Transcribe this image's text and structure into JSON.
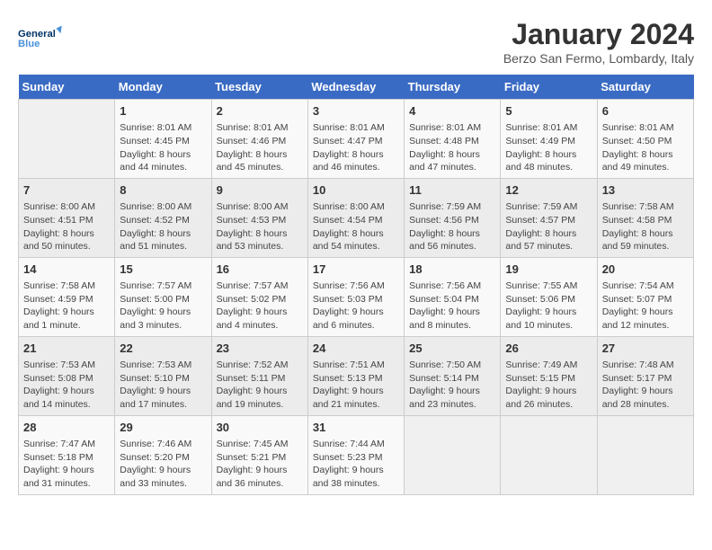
{
  "header": {
    "logo_line1": "General",
    "logo_line2": "Blue",
    "month": "January 2024",
    "location": "Berzo San Fermo, Lombardy, Italy"
  },
  "days_of_week": [
    "Sunday",
    "Monday",
    "Tuesday",
    "Wednesday",
    "Thursday",
    "Friday",
    "Saturday"
  ],
  "weeks": [
    [
      {
        "day": "",
        "info": ""
      },
      {
        "day": "1",
        "info": "Sunrise: 8:01 AM\nSunset: 4:45 PM\nDaylight: 8 hours\nand 44 minutes."
      },
      {
        "day": "2",
        "info": "Sunrise: 8:01 AM\nSunset: 4:46 PM\nDaylight: 8 hours\nand 45 minutes."
      },
      {
        "day": "3",
        "info": "Sunrise: 8:01 AM\nSunset: 4:47 PM\nDaylight: 8 hours\nand 46 minutes."
      },
      {
        "day": "4",
        "info": "Sunrise: 8:01 AM\nSunset: 4:48 PM\nDaylight: 8 hours\nand 47 minutes."
      },
      {
        "day": "5",
        "info": "Sunrise: 8:01 AM\nSunset: 4:49 PM\nDaylight: 8 hours\nand 48 minutes."
      },
      {
        "day": "6",
        "info": "Sunrise: 8:01 AM\nSunset: 4:50 PM\nDaylight: 8 hours\nand 49 minutes."
      }
    ],
    [
      {
        "day": "7",
        "info": "Sunrise: 8:00 AM\nSunset: 4:51 PM\nDaylight: 8 hours\nand 50 minutes."
      },
      {
        "day": "8",
        "info": "Sunrise: 8:00 AM\nSunset: 4:52 PM\nDaylight: 8 hours\nand 51 minutes."
      },
      {
        "day": "9",
        "info": "Sunrise: 8:00 AM\nSunset: 4:53 PM\nDaylight: 8 hours\nand 53 minutes."
      },
      {
        "day": "10",
        "info": "Sunrise: 8:00 AM\nSunset: 4:54 PM\nDaylight: 8 hours\nand 54 minutes."
      },
      {
        "day": "11",
        "info": "Sunrise: 7:59 AM\nSunset: 4:56 PM\nDaylight: 8 hours\nand 56 minutes."
      },
      {
        "day": "12",
        "info": "Sunrise: 7:59 AM\nSunset: 4:57 PM\nDaylight: 8 hours\nand 57 minutes."
      },
      {
        "day": "13",
        "info": "Sunrise: 7:58 AM\nSunset: 4:58 PM\nDaylight: 8 hours\nand 59 minutes."
      }
    ],
    [
      {
        "day": "14",
        "info": "Sunrise: 7:58 AM\nSunset: 4:59 PM\nDaylight: 9 hours\nand 1 minute."
      },
      {
        "day": "15",
        "info": "Sunrise: 7:57 AM\nSunset: 5:00 PM\nDaylight: 9 hours\nand 3 minutes."
      },
      {
        "day": "16",
        "info": "Sunrise: 7:57 AM\nSunset: 5:02 PM\nDaylight: 9 hours\nand 4 minutes."
      },
      {
        "day": "17",
        "info": "Sunrise: 7:56 AM\nSunset: 5:03 PM\nDaylight: 9 hours\nand 6 minutes."
      },
      {
        "day": "18",
        "info": "Sunrise: 7:56 AM\nSunset: 5:04 PM\nDaylight: 9 hours\nand 8 minutes."
      },
      {
        "day": "19",
        "info": "Sunrise: 7:55 AM\nSunset: 5:06 PM\nDaylight: 9 hours\nand 10 minutes."
      },
      {
        "day": "20",
        "info": "Sunrise: 7:54 AM\nSunset: 5:07 PM\nDaylight: 9 hours\nand 12 minutes."
      }
    ],
    [
      {
        "day": "21",
        "info": "Sunrise: 7:53 AM\nSunset: 5:08 PM\nDaylight: 9 hours\nand 14 minutes."
      },
      {
        "day": "22",
        "info": "Sunrise: 7:53 AM\nSunset: 5:10 PM\nDaylight: 9 hours\nand 17 minutes."
      },
      {
        "day": "23",
        "info": "Sunrise: 7:52 AM\nSunset: 5:11 PM\nDaylight: 9 hours\nand 19 minutes."
      },
      {
        "day": "24",
        "info": "Sunrise: 7:51 AM\nSunset: 5:13 PM\nDaylight: 9 hours\nand 21 minutes."
      },
      {
        "day": "25",
        "info": "Sunrise: 7:50 AM\nSunset: 5:14 PM\nDaylight: 9 hours\nand 23 minutes."
      },
      {
        "day": "26",
        "info": "Sunrise: 7:49 AM\nSunset: 5:15 PM\nDaylight: 9 hours\nand 26 minutes."
      },
      {
        "day": "27",
        "info": "Sunrise: 7:48 AM\nSunset: 5:17 PM\nDaylight: 9 hours\nand 28 minutes."
      }
    ],
    [
      {
        "day": "28",
        "info": "Sunrise: 7:47 AM\nSunset: 5:18 PM\nDaylight: 9 hours\nand 31 minutes."
      },
      {
        "day": "29",
        "info": "Sunrise: 7:46 AM\nSunset: 5:20 PM\nDaylight: 9 hours\nand 33 minutes."
      },
      {
        "day": "30",
        "info": "Sunrise: 7:45 AM\nSunset: 5:21 PM\nDaylight: 9 hours\nand 36 minutes."
      },
      {
        "day": "31",
        "info": "Sunrise: 7:44 AM\nSunset: 5:23 PM\nDaylight: 9 hours\nand 38 minutes."
      },
      {
        "day": "",
        "info": ""
      },
      {
        "day": "",
        "info": ""
      },
      {
        "day": "",
        "info": ""
      }
    ]
  ]
}
